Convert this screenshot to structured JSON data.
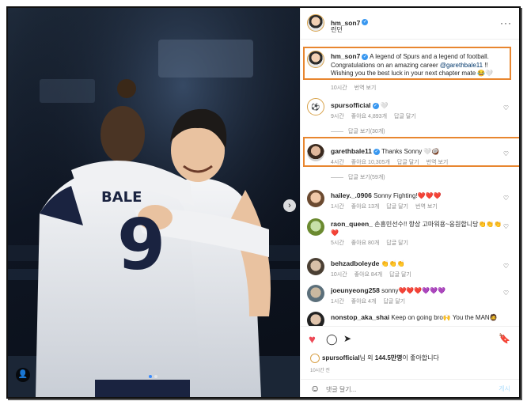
{
  "post": {
    "author": "hm_son7",
    "location": "런던",
    "more_label": "···"
  },
  "photo": {
    "jersey_number": "9",
    "jersey_name": "BALE",
    "next_glyph": "›",
    "tag_glyph": "👤"
  },
  "caption": {
    "username": "hm_son7",
    "text_before_mention": "A legend of Spurs and a legend of football. Congratulations on an amazing career ",
    "mention": "@garethbale11",
    "text_after_mention": " !! Wishing you the best luck in your next chapter mate 😂🤍",
    "time": "10시간",
    "translate": "번역 보기"
  },
  "comments": [
    {
      "username": "spursofficial",
      "text": "🤍",
      "time": "9시간",
      "likes": "좋아요 4,893개",
      "reply": "답글 달기",
      "translate": "",
      "replies": "답글 보기(30개)"
    },
    {
      "username": "garethbale11",
      "text": "Thanks Sonny 🤍🥥",
      "time": "4시간",
      "likes": "좋아요 10,305개",
      "reply": "답글 달기",
      "translate": "번역 보기",
      "replies": "답글 보기(59개)"
    },
    {
      "username": "hailey._.0906",
      "text": "Sonny Fighting!❤️❤️❤️",
      "time": "1시간",
      "likes": "좋아요 13개",
      "reply": "답글 달기",
      "translate": "번역 보기",
      "replies": ""
    },
    {
      "username": "raon_queen_",
      "text": "손흥민선수!! 항상 고마워용~응원합니당👏👏👏 ❤️",
      "time": "5시간",
      "likes": "좋아요 80개",
      "reply": "답글 달기",
      "translate": "",
      "replies": ""
    },
    {
      "username": "behzadboleyde",
      "text": "👏👏👏",
      "time": "10시간",
      "likes": "좋아요 84개",
      "reply": "답글 달기",
      "translate": "",
      "replies": ""
    },
    {
      "username": "joeunyeong258",
      "text": "sonny❤️❤️❤️💜💜💜",
      "time": "1시간",
      "likes": "좋아요 4개",
      "reply": "답글 달기",
      "translate": "",
      "replies": ""
    },
    {
      "username": "nonstop_aka_shai",
      "text": "Keep on going bro🙌 You the MAN🧔",
      "time": "",
      "likes": "",
      "reply": "",
      "translate": "",
      "replies": ""
    }
  ],
  "actions": {
    "like_icon": "♥",
    "comment_icon": "◯",
    "share_icon": "➤",
    "save_icon": "🔖",
    "liked_by_user": "spursofficial",
    "liked_by_middle": "님 외 ",
    "liked_count": "144.5만명",
    "liked_by_suffix": "이 좋아합니다",
    "time_ago": "10시간 전"
  },
  "add_comment": {
    "emoji_icon": "☺",
    "placeholder": "댓글 달기...",
    "post_label": "게시"
  },
  "colors": {
    "highlight": "#e8862f",
    "like_red": "#ed4956",
    "verified_blue": "#3897f0",
    "mention_blue": "#00376b"
  }
}
